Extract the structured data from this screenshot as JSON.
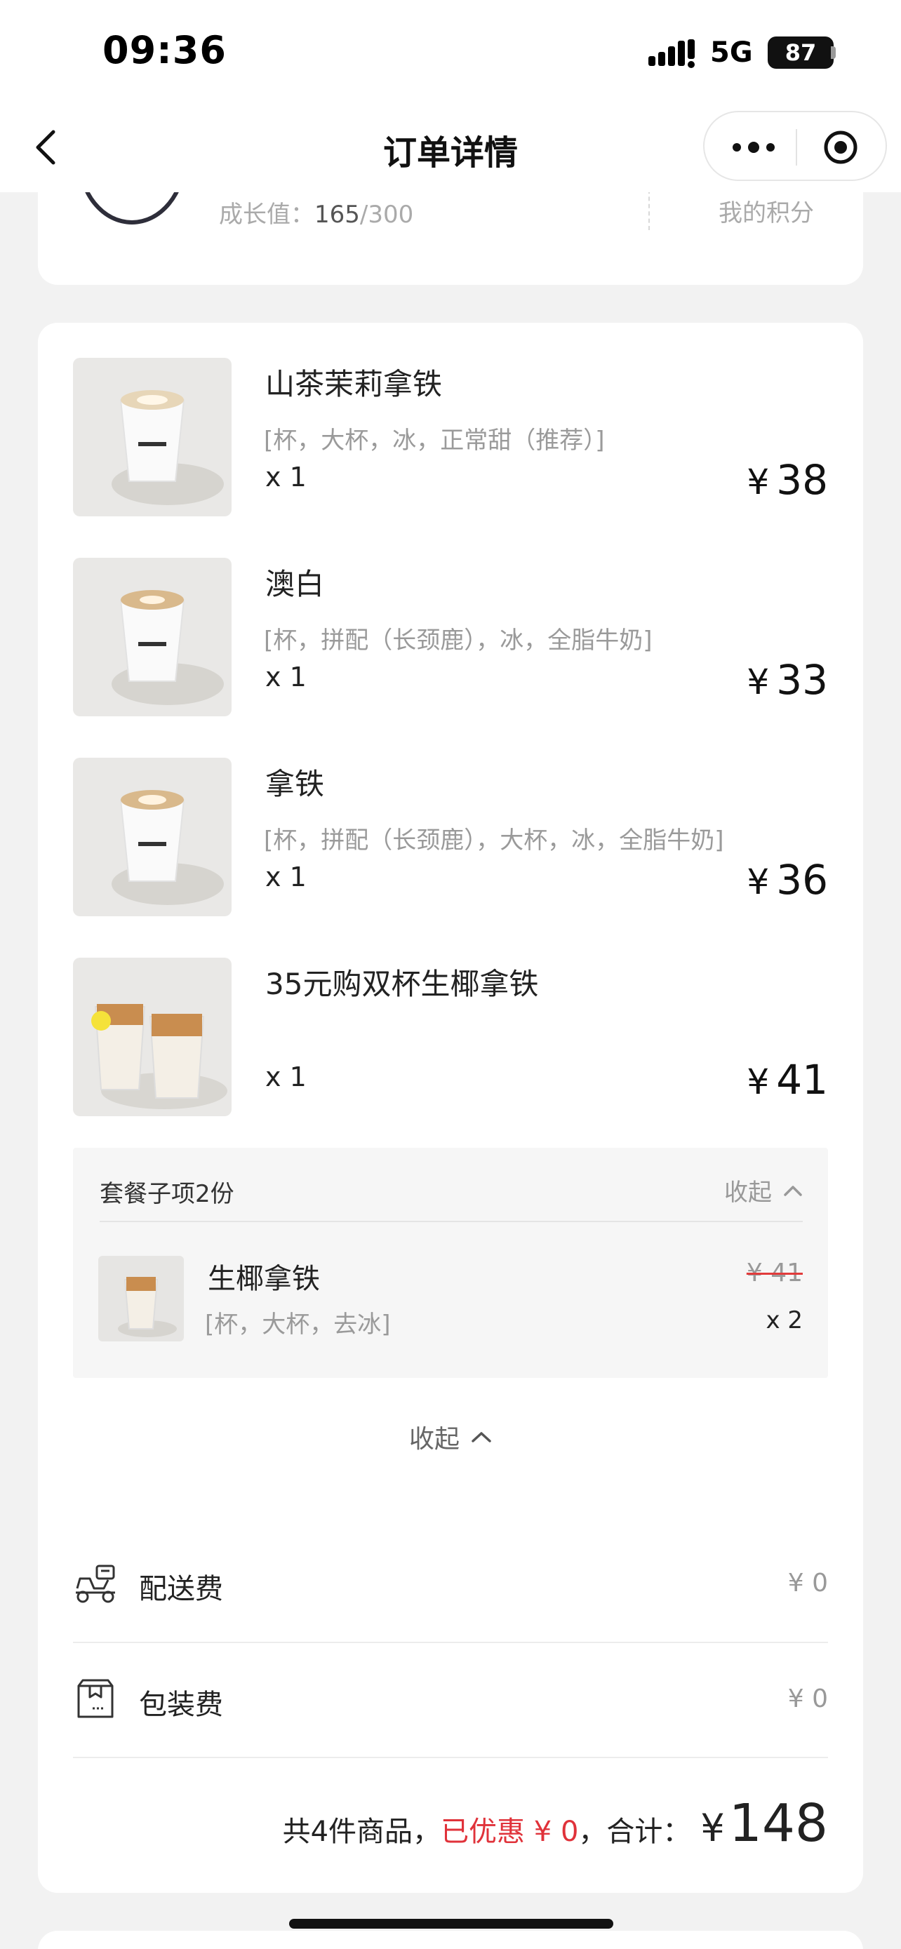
{
  "status_bar": {
    "time": "09:36",
    "network": "5G",
    "battery": "87"
  },
  "nav": {
    "title": "订单详情"
  },
  "member": {
    "growth_label": "成长值：",
    "growth_current": "165",
    "growth_total": "/300",
    "points_label": "我的积分"
  },
  "items": [
    {
      "name": "山茶茉莉拿铁",
      "spec": "[杯，大杯，冰，正常甜（推荐）]",
      "qty": "x 1",
      "currency": "¥",
      "price": "38"
    },
    {
      "name": "澳白",
      "spec": "[杯，拼配（长颈鹿），冰，全脂牛奶]",
      "qty": "x 1",
      "currency": "¥",
      "price": "33"
    },
    {
      "name": "拿铁",
      "spec": "[杯，拼配（长颈鹿），大杯，冰，全脂牛奶]",
      "qty": "x 1",
      "currency": "¥",
      "price": "36"
    },
    {
      "name": "35元购双杯生椰拿铁",
      "spec": "",
      "qty": "x 1",
      "currency": "¥",
      "price": "41"
    }
  ],
  "combo": {
    "title": "套餐子项2份",
    "collapse_label": "收起",
    "sub_item": {
      "name": "生椰拿铁",
      "spec": "[杯，大杯，去冰]",
      "original_price": "¥ 41",
      "qty": "x 2"
    }
  },
  "collapse_label": "收起",
  "fees": [
    {
      "label": "配送费",
      "value": "¥ 0",
      "icon": "scooter-icon"
    },
    {
      "label": "包装费",
      "value": "¥ 0",
      "icon": "package-icon"
    }
  ],
  "summary": {
    "count_text": "共4件商品，",
    "discount_text": "已优惠 ¥ 0",
    "total_label": "，合计：",
    "currency": "¥",
    "total": "148"
  },
  "colors": {
    "discount_red": "#e0323a",
    "background": "#f2f2f2"
  }
}
